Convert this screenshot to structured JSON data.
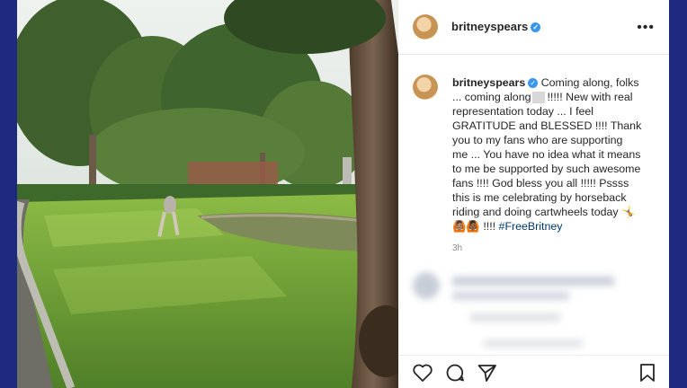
{
  "post": {
    "username": "britneyspears",
    "more_label": "•••",
    "caption": {
      "line1": "Coming along, folks",
      "line2a": "... coming along",
      "line2b": "!!!!! New with real",
      "line3": "representation today ... I feel",
      "line4": "GRATITUDE and BLESSED !!!! Thank",
      "line5": "you to my fans who are supporting",
      "line6": "me ... You have no idea what it means",
      "line7": "to me be supported by such awesome",
      "line8": "fans !!!! God bless you all !!!!! Pssss",
      "line9": "this is me celebrating by horseback",
      "line10": "riding and doing cartwheels today",
      "emoji1": "🤸",
      "emoji_pair": "🙆🏽🙆🏾",
      "tail": "!!!!",
      "hashtag": "#FreeBritney"
    },
    "time": "3h"
  },
  "actions": {
    "like_icon": "heart-icon",
    "comment_icon": "comment-icon",
    "share_icon": "share-icon",
    "save_icon": "bookmark-icon"
  }
}
